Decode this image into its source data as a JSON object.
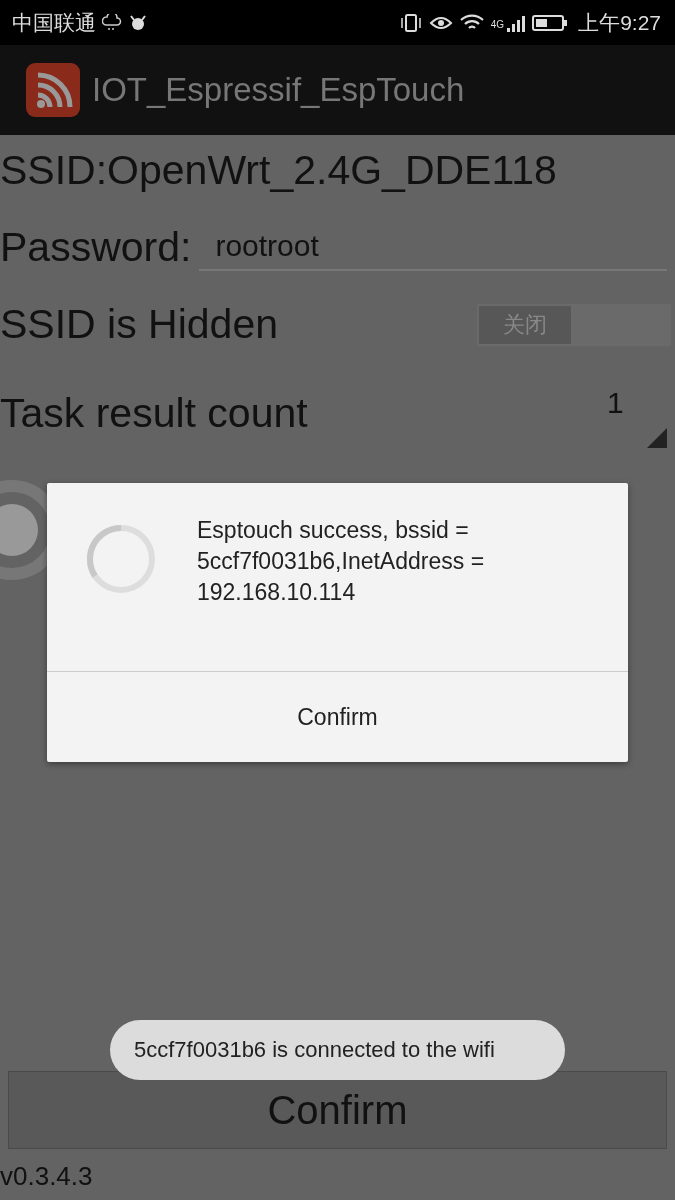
{
  "status_bar": {
    "carrier": "中国联通",
    "time": "上午9:27",
    "network": "4G"
  },
  "app_bar": {
    "title": "IOT_Espressif_EspTouch"
  },
  "form": {
    "ssid": "SSID:OpenWrt_2.4G_DDE118",
    "password_label": "Password:",
    "password_value": "rootroot",
    "hidden_label": "SSID is Hidden",
    "hidden_toggle": {
      "label": "关闭",
      "on": false
    },
    "count_label": "Task result count",
    "count_value": "1"
  },
  "dialog": {
    "message": "Esptouch success, bssid = 5ccf7f0031b6,InetAddress = 192.168.10.114",
    "button": "Confirm"
  },
  "toast": "5ccf7f0031b6 is connected to the wifi",
  "confirm_button": "Confirm",
  "version": "v0.3.4.3"
}
